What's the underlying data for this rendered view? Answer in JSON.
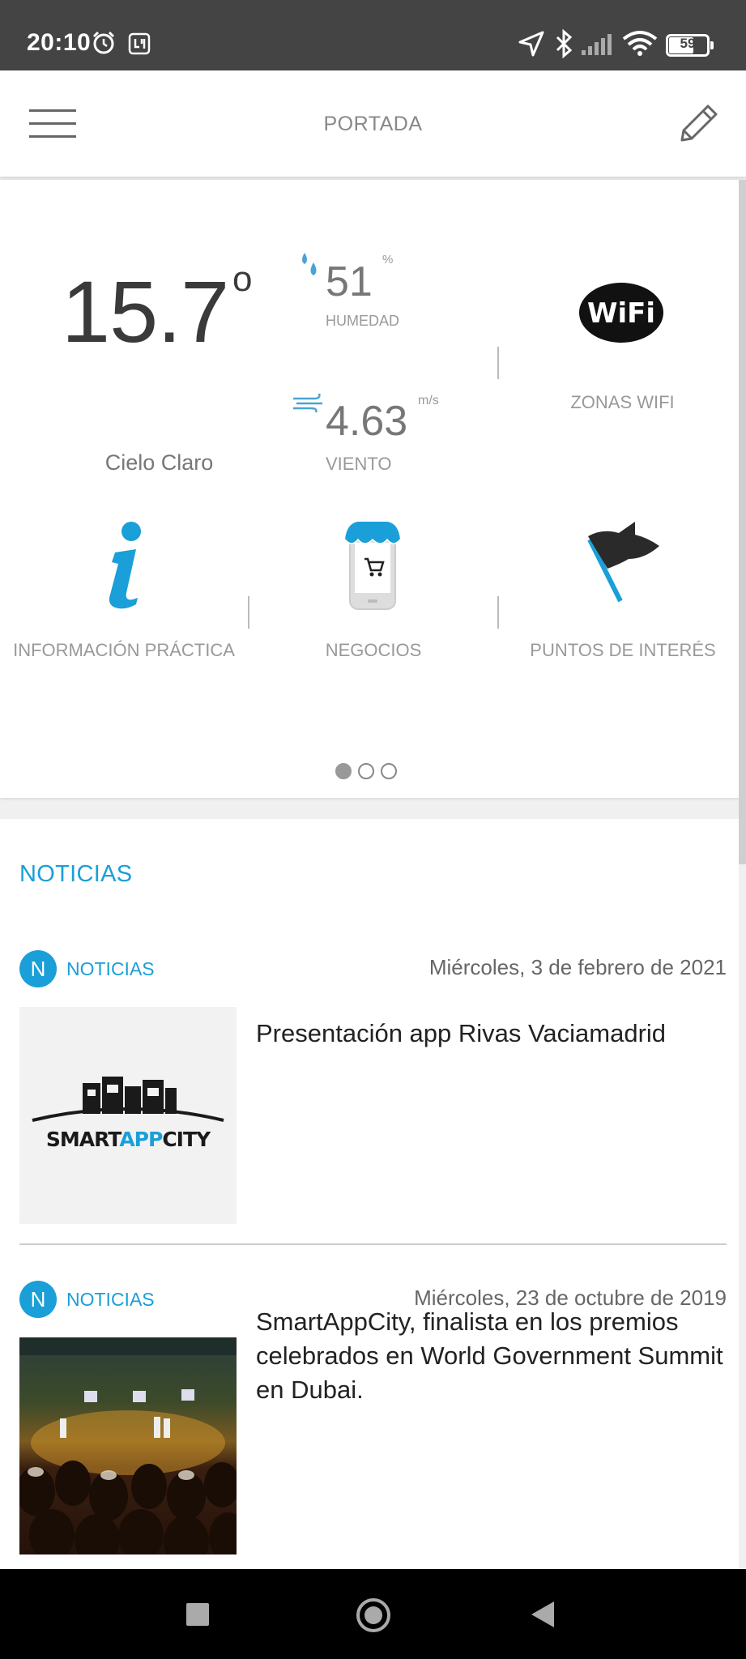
{
  "status_bar": {
    "time": "20:10",
    "battery": "59",
    "icons": [
      "alarm-icon",
      "notification-icon",
      "location-icon",
      "bluetooth-icon",
      "signal-icon",
      "wifi-icon",
      "battery-icon"
    ]
  },
  "header": {
    "title": "PORTADA",
    "menu_icon": "hamburger-menu-icon",
    "edit_icon": "pencil-edit-icon"
  },
  "weather": {
    "temperature": "15.7",
    "degree_symbol": "o",
    "sky": "Cielo Claro",
    "humidity_value": "51",
    "humidity_unit": "%",
    "humidity_label": "HUMEDAD",
    "wind_value": "4.63",
    "wind_unit": "m/s",
    "wind_label": "VIENTO"
  },
  "shortcuts": [
    {
      "label": "ZONAS WIFI",
      "icon": "wifi-logo-icon"
    },
    {
      "label": "INFORMACIÓN PRÁCTICA",
      "icon": "info-icon"
    },
    {
      "label": "NEGOCIOS",
      "icon": "shop-phone-icon"
    },
    {
      "label": "PUNTOS DE INTERÉS",
      "icon": "flag-icon"
    }
  ],
  "pager": {
    "pages": 3,
    "active": 1
  },
  "news": {
    "heading": "NOTICIAS",
    "items": [
      {
        "badge": "N",
        "category": "NOTICIAS",
        "date": "Miércoles, 3 de febrero de 2021",
        "title": "Presentación app Rivas Vaciamadrid",
        "thumb_logo_text_1": "SMART",
        "thumb_logo_text_2": "APP",
        "thumb_logo_text_3": "CITY"
      },
      {
        "badge": "N",
        "category": "NOTICIAS",
        "date": "Miércoles, 23 de octubre de 2019",
        "title": "SmartAppCity, finalista en los premios celebrados en World Government Summit en Dubai."
      }
    ]
  },
  "colors": {
    "accent": "#1a9fd8",
    "status_bar": "#444444",
    "flag": "#2a2a2a"
  }
}
